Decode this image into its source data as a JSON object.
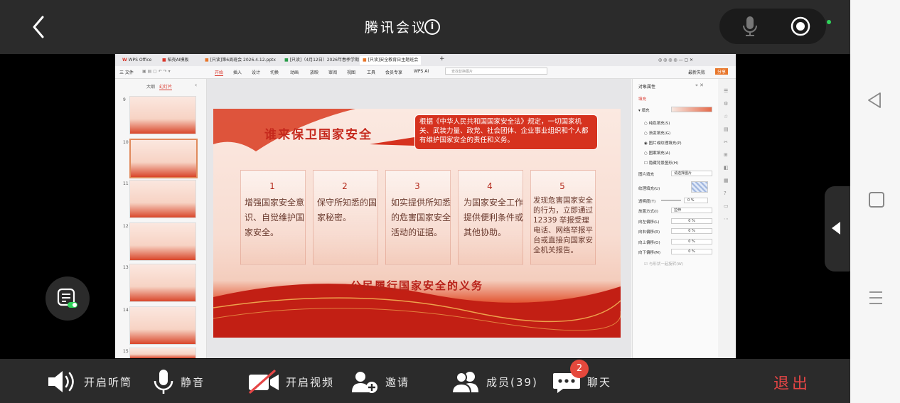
{
  "header": {
    "title": "腾讯会议",
    "info_glyph": "i"
  },
  "wps": {
    "tabs": [
      {
        "label": "WPS Office"
      },
      {
        "label": "稻壳AI模板"
      },
      {
        "label": "[只读]第6周班会 2026.4.12.pptx"
      },
      {
        "label": "[只读]（4月12日）2026年春季学期"
      },
      {
        "label": "[只读]安全教育日主题班会"
      }
    ],
    "file_menu": "三 文件",
    "menu_tabs": [
      "开始",
      "插入",
      "设计",
      "切换",
      "动画",
      "放映",
      "审阅",
      "视图",
      "工具",
      "会员专享",
      "WPS AI"
    ],
    "search_placeholder": "查找替换图片",
    "top_right": [
      "最新失败",
      "分享"
    ],
    "pane_tabs": [
      "大纲",
      "幻灯片"
    ],
    "thumb_numbers": [
      "9",
      "10",
      "11",
      "12",
      "13",
      "14",
      "15"
    ]
  },
  "slide": {
    "title": "谁来保卫国家安全",
    "bubble": "根据《中华人民共和国国家安全法》规定，一切国家机关、武装力量、政党、社会团体、企业事业组织和个人都有维护国家安全的责任和义务。",
    "cards": [
      {
        "num": "1",
        "text": "增强国家安全意识、自觉维护国家安全。"
      },
      {
        "num": "2",
        "text": "保守所知悉的国家秘密。"
      },
      {
        "num": "3",
        "text": "如实提供所知悉的危害国家安全活动的证据。"
      },
      {
        "num": "4",
        "text": "为国家安全工作提供便利条件或其他协助。"
      },
      {
        "num": "5",
        "text": "发现危害国家安全的行为，立即通过 12339 举报受理电话、网络举报平台或直接向国家安全机关报告。"
      }
    ],
    "footer": "公民履行国家安全的义务"
  },
  "props": {
    "title": "对象属性",
    "fill_tab": "填充",
    "fill_section": "▾ 填充",
    "options": [
      "纯色填充(S)",
      "渐变填充(G)",
      "图片或纹理填充(P)",
      "图案填充(A)",
      "隐藏背景图形(H)"
    ],
    "picture_fill_label": "图片填充",
    "picture_fill_value": "请选择图片",
    "texture_label": "纹理填充(U)",
    "transparency_label": "透明度(T)",
    "transparency_value": "0",
    "transparency_unit": "%",
    "placement_label": "放置方式(I)",
    "placement_value": "拉伸",
    "offsets": [
      {
        "label": "向左偏移(L)",
        "value": "0 %"
      },
      {
        "label": "向右偏移(R)",
        "value": "0 %"
      },
      {
        "label": "向上偏移(O)",
        "value": "0 %"
      },
      {
        "label": "向下偏移(M)",
        "value": "0 %"
      }
    ],
    "rotate_label": "与形状一起旋转(W)"
  },
  "bottom": {
    "speaker": "开启听筒",
    "mute": "静音",
    "video": "开启视频",
    "invite": "邀请",
    "members": "成员(39)",
    "chat": "聊天",
    "chat_badge": "2",
    "exit": "退出"
  },
  "colors": {
    "bar_bg": "#2b2b2b",
    "exit_red": "#e54545",
    "slide_red": "#c5281c",
    "badge_red": "#e5483c"
  }
}
